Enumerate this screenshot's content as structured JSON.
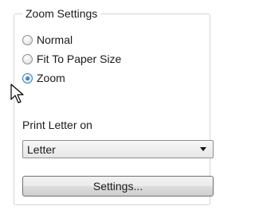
{
  "zoom_settings": {
    "title": "Zoom Settings",
    "options": [
      {
        "label": "Normal",
        "selected": false
      },
      {
        "label": "Fit To Paper Size",
        "selected": false
      },
      {
        "label": "Zoom",
        "selected": true
      }
    ],
    "print_letter_label": "Print Letter on",
    "paper_select": {
      "value": "Letter"
    },
    "settings_button_label": "Settings..."
  }
}
